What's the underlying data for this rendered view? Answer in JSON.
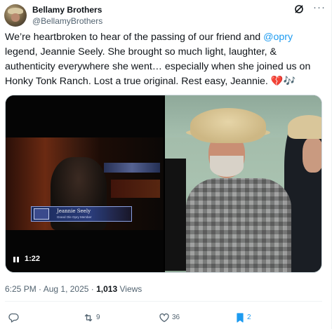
{
  "author": {
    "name": "Bellamy Brothers",
    "handle": "@BellamyBrothers"
  },
  "tweet": {
    "text_before": "We’re heartbroken to hear of the passing of our friend and ",
    "mention": "@opry",
    "text_after": " legend, Jeannie Seely. She brought so much light, laughter, & authenticity everywhere she went… especially when she joined us on Honky Tonk Ranch. Lost a true original. Rest easy, Jeannie. ",
    "emoji": "💔🎶"
  },
  "video": {
    "lower_third_name": "Jeannie Seely",
    "lower_third_sub": "Grand Ole Opry Member",
    "duration": "1:22"
  },
  "meta": {
    "time": "6:25 PM",
    "separator": " · ",
    "date": "Aug 1, 2025",
    "views_count": "1,013",
    "views_label": " Views"
  },
  "actions": {
    "replies": "",
    "reposts": "9",
    "likes": "36",
    "bookmarks": "2"
  },
  "colors": {
    "accent": "#1d9bf0",
    "text": "#0f1419",
    "muted": "#536471"
  }
}
